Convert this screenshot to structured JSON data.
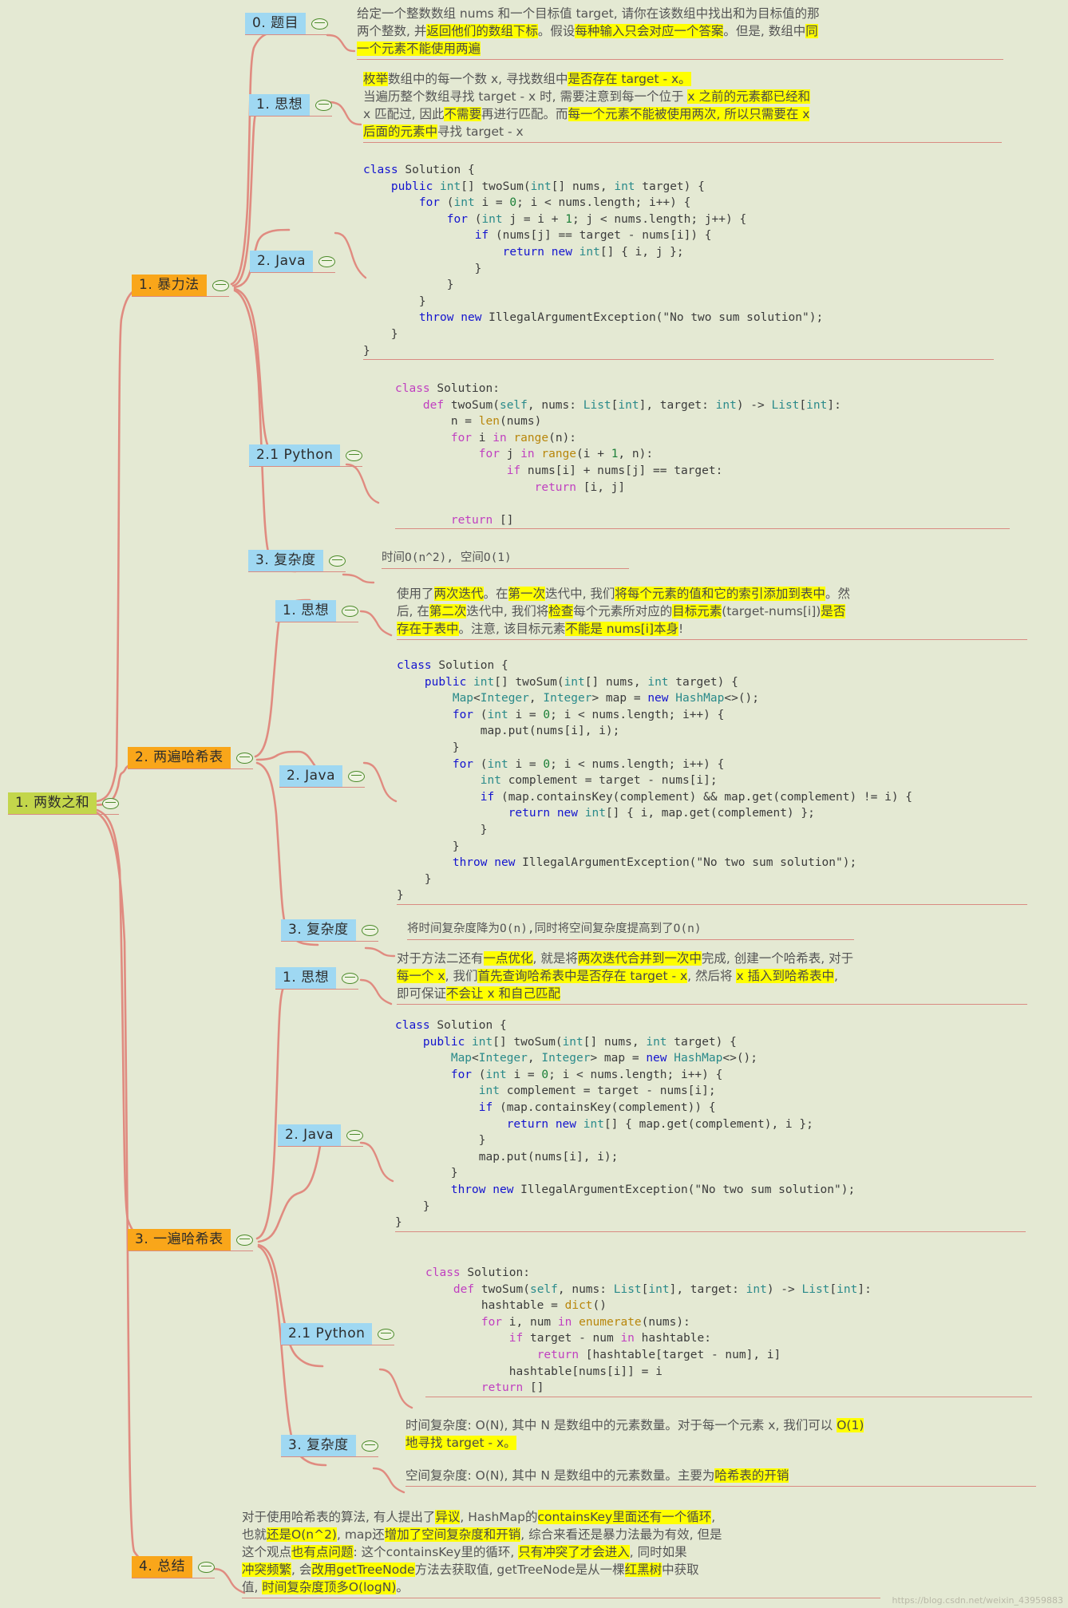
{
  "meta": {
    "watermark": "https://blog.csdn.net/weixin_43959883",
    "colors": {
      "background": "#e4e9d3",
      "root_chip": "#c3d64b",
      "level1_chip": "#f9a61a",
      "level2_chip": "#9fd8f2",
      "branch_line": "#e08b80",
      "highlight": "#ffff00",
      "toggle_border": "#4c8b2b"
    }
  },
  "root": {
    "label": "1. 两数之和"
  },
  "branches": [
    {
      "id": "b0",
      "label": "0. 题目",
      "level": 2
    },
    {
      "id": "b1",
      "label": "1. 思想",
      "level": 2
    },
    {
      "id": "m1",
      "label": "1. 暴力法",
      "level": 1
    },
    {
      "id": "b2",
      "label": "2. Java",
      "level": 2
    },
    {
      "id": "b21",
      "label": "2.1 Python",
      "level": 2
    },
    {
      "id": "b3",
      "label": "3. 复杂度",
      "level": 2
    },
    {
      "id": "c1",
      "label": "1. 思想",
      "level": 2
    },
    {
      "id": "m2",
      "label": "2. 两遍哈希表",
      "level": 1
    },
    {
      "id": "c2",
      "label": "2. Java",
      "level": 2
    },
    {
      "id": "c3",
      "label": "3. 复杂度",
      "level": 2
    },
    {
      "id": "d1",
      "label": "1. 思想",
      "level": 2
    },
    {
      "id": "d2",
      "label": "2. Java",
      "level": 2
    },
    {
      "id": "m3",
      "label": "3. 一遍哈希表",
      "level": 1
    },
    {
      "id": "d21",
      "label": "2.1 Python",
      "level": 2
    },
    {
      "id": "d3",
      "label": "3. 复杂度",
      "level": 2
    },
    {
      "id": "m4",
      "label": "4. 总结",
      "level": 1
    }
  ],
  "content": {
    "problem": {
      "line1_a": "给定一个整数数组 nums 和一个目标值 target, 请你在该数组中找出和为目标值的那",
      "line2_a": "两个整数, 并",
      "line2_hl1": "返回他们的数组下标",
      "line2_b": "。假设",
      "line2_hl2": "每种输入只会对应一个答案",
      "line2_c": "。但是, 数组中",
      "line2_hl3": "同",
      "line3_hl": "一个元素不能使用两遍"
    },
    "idea1": {
      "l1_hl1": "枚举",
      "l1_a": "数组中的每一个数 x, 寻找数组中",
      "l1_hl2": "是否存在 target - x。",
      "l2_a": "当遍历整个数组寻找 target - x 时, 需要注意到每一个位于 ",
      "l2_hl1": "x 之前的元素都已经和",
      "l3_a": "x 匹配过, 因此",
      "l3_hl1": "不需要",
      "l3_b": "再进行匹配。而",
      "l3_hl2": "每一个元素不能被使用两次, 所以只需要在 x",
      "l4_hl": "后面的元素中",
      "l4_a": "寻找 target - x"
    },
    "java1": "class Solution {\n    public int[] twoSum(int[] nums, int target) {\n        for (int i = 0; i < nums.length; i++) {\n            for (int j = i + 1; j < nums.length; j++) {\n                if (nums[j] == target - nums[i]) {\n                    return new int[] { i, j };\n                }\n            }\n        }\n        throw new IllegalArgumentException(\"No two sum solution\");\n    }\n}",
    "python1": "class Solution:\n    def twoSum(self, nums: List[int], target: int) -> List[int]:\n        n = len(nums)\n        for i in range(n):\n            for j in range(i + 1, n):\n                if nums[i] + nums[j] == target:\n                    return [i, j]\n\n        return []",
    "complexity1": "时间O(n^2), 空间O(1)",
    "idea2": {
      "l1_a": "使用了",
      "l1_hl1": "两次迭代",
      "l1_b": "。在",
      "l1_hl2": "第一次",
      "l1_c": "迭代中, 我们",
      "l1_hl3": "将每个元素的值和它的索引添加到表中",
      "l1_d": "。然",
      "l2_a": "后, 在",
      "l2_hl1": "第二次",
      "l2_b": "迭代中, 我们将",
      "l2_hl2": "检查",
      "l2_c": "每个元素所对应的",
      "l2_hl3": "目标元素",
      "l2_d": "(target-nums[i])",
      "l2_hl4": "是否",
      "l3_hl1": "存在于表中",
      "l3_a": "。注意, 该目标元素",
      "l3_hl2": "不能是 nums[i]本身",
      "l3_b": "!"
    },
    "java2": "class Solution {\n    public int[] twoSum(int[] nums, int target) {\n        Map<Integer, Integer> map = new HashMap<>();\n        for (int i = 0; i < nums.length; i++) {\n            map.put(nums[i], i);\n        }\n        for (int i = 0; i < nums.length; i++) {\n            int complement = target - nums[i];\n            if (map.containsKey(complement) && map.get(complement) != i) {\n                return new int[] { i, map.get(complement) };\n            }\n        }\n        throw new IllegalArgumentException(\"No two sum solution\");\n    }\n}",
    "complexity2": "将时间复杂度降为O(n),同时将空间复杂度提高到了O(n)",
    "idea3": {
      "l1_a": "对于方法二还有",
      "l1_hl1": "一点优化",
      "l1_b": ", 就是将",
      "l1_hl2": "两次迭代合并到一次中",
      "l1_c": "完成, 创建一个哈希表, 对于",
      "l2_hl1": "每一个 x",
      "l2_a": ", 我们",
      "l2_hl2": "首先查询哈希表中是否存在 target - x",
      "l2_b": ", 然后将 ",
      "l2_hl3": "x 插入到哈希表中",
      "l2_c": ",",
      "l3_a": "即可保证",
      "l3_hl1": "不会让 x 和自己匹配"
    },
    "java3": "class Solution {\n    public int[] twoSum(int[] nums, int target) {\n        Map<Integer, Integer> map = new HashMap<>();\n        for (int i = 0; i < nums.length; i++) {\n            int complement = target - nums[i];\n            if (map.containsKey(complement)) {\n                return new int[] { map.get(complement), i };\n            }\n            map.put(nums[i], i);\n        }\n        throw new IllegalArgumentException(\"No two sum solution\");\n    }\n}",
    "python3": "class Solution:\n    def twoSum(self, nums: List[int], target: int) -> List[int]:\n        hashtable = dict()\n        for i, num in enumerate(nums):\n            if target - num in hashtable:\n                return [hashtable[target - num], i]\n            hashtable[nums[i]] = i\n        return []",
    "complexity3": {
      "t_l1_a": "时间复杂度: O(N), 其中 N 是数组中的元素数量。对于每一个元素 x, 我们可以 ",
      "t_l1_hl": "O(1)",
      "t_l2_hl": "地寻找 target - x。",
      "s_l1_a": "空间复杂度: O(N), 其中 N 是数组中的元素数量。主要为",
      "s_l1_hl": "哈希表的开销"
    },
    "summary": {
      "l1_a": "对于使用哈希表的算法, 有人提出了",
      "l1_hl1": "异议",
      "l1_b": ", HashMap的",
      "l1_hl2": "containsKey里面还有一个循环",
      "l1_c": ",",
      "l2_a": "也就",
      "l2_hl1": "还是O(n^2)",
      "l2_b": ", map还",
      "l2_hl2": "增加了空间复杂度和开销",
      "l2_c": ", 综合来看还是暴力法最为有效, 但是",
      "l3_a": "这个观点",
      "l3_hl1": "也有点问题",
      "l3_b": ": 这个containsKey里的循环, ",
      "l3_hl2": "只有冲突了才会进入",
      "l3_c": ", 同时如果",
      "l4_hl1": "冲突频繁",
      "l4_a": ", 会",
      "l4_hl2": "改用getTreeNode",
      "l4_b": "方法去获取值, getTreeNode是从一棵",
      "l4_hl3": "红黑树",
      "l4_c": "中获取",
      "l5_a": "值, ",
      "l5_hl1": "时间复杂度顶多O(logN)",
      "l5_b": "。"
    }
  }
}
